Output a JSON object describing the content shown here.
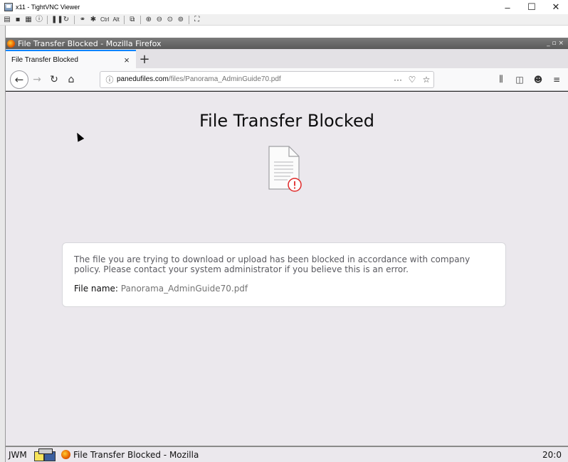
{
  "vnc": {
    "title": "x11 - TightVNC Viewer",
    "controls": {
      "minimize": "–",
      "maximize": "☐",
      "close": "✕"
    },
    "toolbar": {
      "ctrl_label": "Ctrl",
      "alt_label": "Alt"
    }
  },
  "firefox": {
    "window_title": "File Transfer Blocked - Mozilla Firefox",
    "window_controls": "_ ▫ ×",
    "tab": {
      "label": "File Transfer Blocked",
      "close": "×",
      "new": "+"
    },
    "url": {
      "host": "panedufiles.com",
      "path": "/files/Panorama_AdminGuide70.pdf"
    },
    "nav_icons": [
      "back-icon",
      "forward-icon",
      "reload-icon",
      "home-icon",
      "info-icon",
      "more-icon",
      "pocket-icon",
      "bookmark-star-icon",
      "library-icon",
      "sidebar-icon",
      "extension-icon",
      "menu-icon"
    ]
  },
  "page": {
    "title": "File Transfer Blocked",
    "message": "The file you are trying to download or upload has been blocked in accordance with company policy. Please contact your system administrator if you believe this is an error.",
    "file_label": "File name:",
    "file_name": "Panorama_AdminGuide70.pdf"
  },
  "taskbar": {
    "wm_label": "JWM",
    "task_label": "File Transfer Blocked - Mozilla",
    "clock": "20:0"
  },
  "colors": {
    "accent": "#0a84ff",
    "page_bg": "#ebe8ed",
    "warning": "#e02a2a"
  }
}
